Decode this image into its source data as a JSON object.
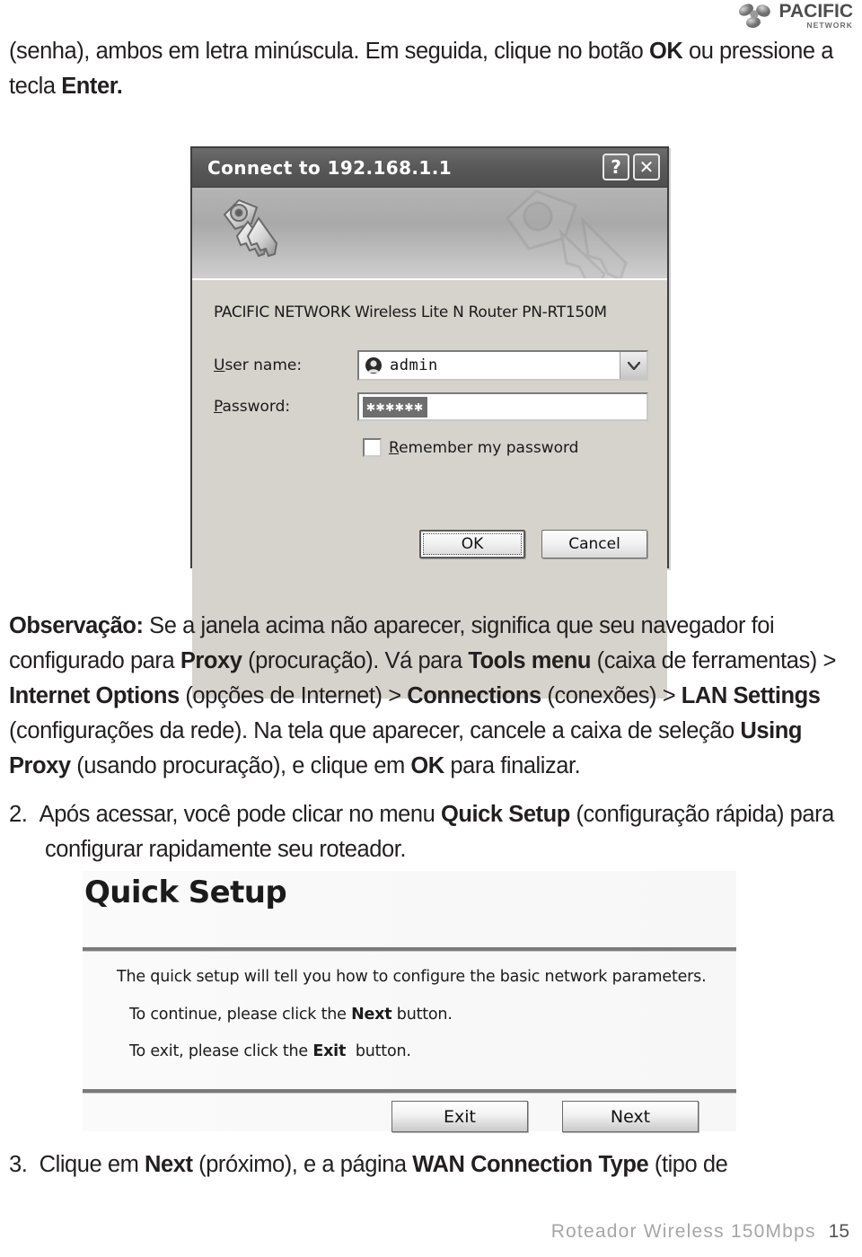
{
  "brand": {
    "name": "PACIFIC",
    "sub": "NETWORK",
    "mark_icon": "pacific-propeller-icon"
  },
  "page": {
    "intro_html": "(senha), ambos em letra minúscula. Em seguida, clique no botão <b>OK</b> ou pressione a tecla <b>Enter.</b>",
    "note_html": "<b>Observação:</b> Se a janela acima não aparecer, significa que seu navegador foi configurado para <b>Proxy</b> (procuração). Vá para <b>Tools menu</b> (caixa de ferramentas) &gt; <b>Internet Options</b> (opções de Internet) &gt; <b>Connections</b> (conexões) &gt; <b>LAN Settings</b> (configurações da rede). Na tela que aparecer, cancele a caixa de seleção <b>Using Proxy</b> (usando procuração), e clique em <b>OK</b> para finalizar.",
    "step2_html": "2.&nbsp;&nbsp;Após acessar, você pode clicar no menu <b>Quick Setup</b> (configuração rápida) para configurar rapidamente seu roteador.",
    "step3_html": "3.&nbsp;&nbsp;Clique em <b>Next</b> (próximo), e a página <b>WAN Connection Type</b> (tipo de"
  },
  "dialog": {
    "title": "Connect to  192.168.1.1",
    "help_button": "?",
    "close_button": "✕",
    "banner_icon": "keys-icon",
    "product_line": "PACIFIC NETWORK  Wireless Lite N Router PN-RT150M",
    "username_label": "User name:",
    "username_label_mnemonic": "U",
    "username_value": "admin",
    "username_icon": "user-avatar-icon",
    "dropdown_icon": "chevron-down-icon",
    "password_label": "Password:",
    "password_label_mnemonic": "P",
    "password_value": "✱✱✱✱✱✱",
    "remember_label": "Remember my password",
    "remember_label_mnemonic": "R",
    "remember_checked": false,
    "ok_label": "OK",
    "cancel_label": "Cancel"
  },
  "quick_setup": {
    "title": "Quick Setup",
    "line1_html": "The quick setup will tell you how to configure the basic network parameters.",
    "line2_html": "To continue, please click the <b>Next</b> button.",
    "line3_html": "To exit, please click the <b>Exit</b>&nbsp; button.",
    "exit_label": "Exit",
    "next_label": "Next"
  },
  "footer": {
    "brandline": "Roteador Wireless 150Mbps",
    "page_number": "15"
  },
  "colors": {
    "text": "#231f20",
    "titlebar": "#5a5a5a",
    "dialog_face": "#d6d3cc",
    "rule": "#7a7a7a",
    "footer_gray": "#a6a6a6"
  }
}
